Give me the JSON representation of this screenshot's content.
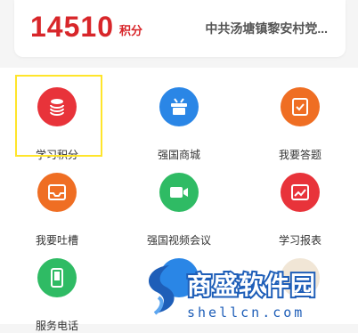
{
  "summary": {
    "points_value": "14510",
    "points_unit": "积分",
    "organization": "中共汤塘镇黎安村党..."
  },
  "grid": {
    "items": [
      {
        "label": "学习积分",
        "icon": "coins-stack-icon",
        "color": "#e8333a"
      },
      {
        "label": "强国商城",
        "icon": "shopping-basket-icon",
        "color": "#2a86e6"
      },
      {
        "label": "我要答题",
        "icon": "checklist-icon",
        "color": "#ef6e23"
      },
      {
        "label": "我要吐槽",
        "icon": "inbox-icon",
        "color": "#ef6e23"
      },
      {
        "label": "强国视频会议",
        "icon": "video-camera-icon",
        "color": "#2fbb64"
      },
      {
        "label": "学习报表",
        "icon": "trend-chart-icon",
        "color": "#e8333a"
      },
      {
        "label": "服务电话",
        "icon": "phone-icon",
        "color": "#2fbb64"
      }
    ]
  },
  "watermark": {
    "brand": "商盛软件园",
    "domain": "shellcn.com"
  }
}
